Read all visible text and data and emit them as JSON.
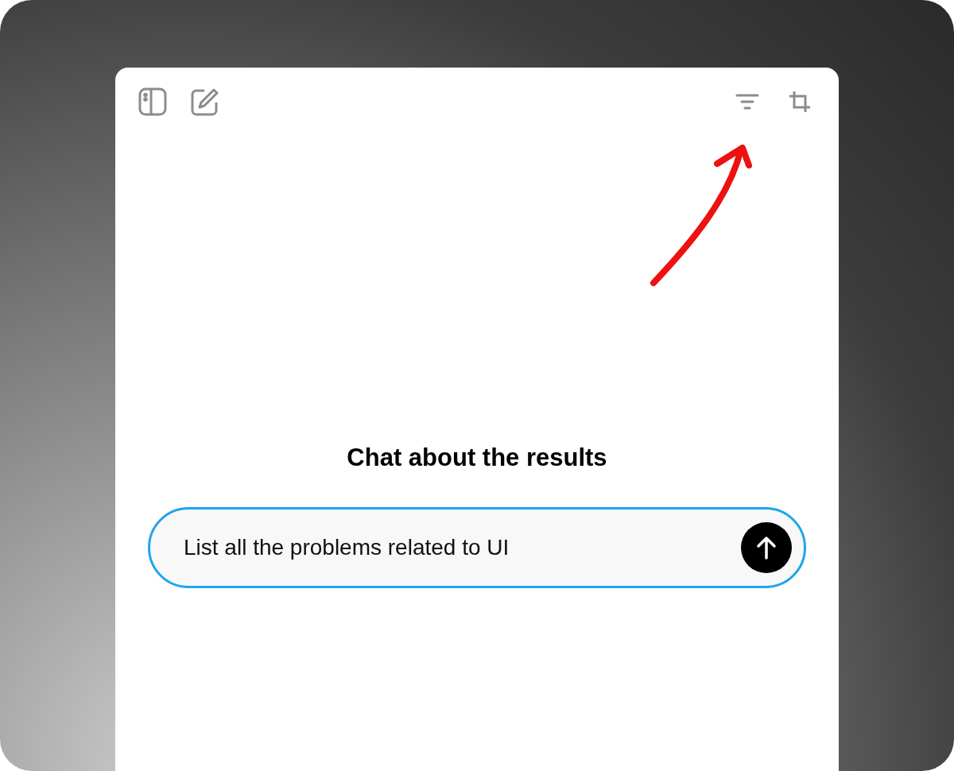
{
  "heading": "Chat about the results",
  "chat_input": {
    "value": "List all the problems related to UI",
    "focused": true
  }
}
